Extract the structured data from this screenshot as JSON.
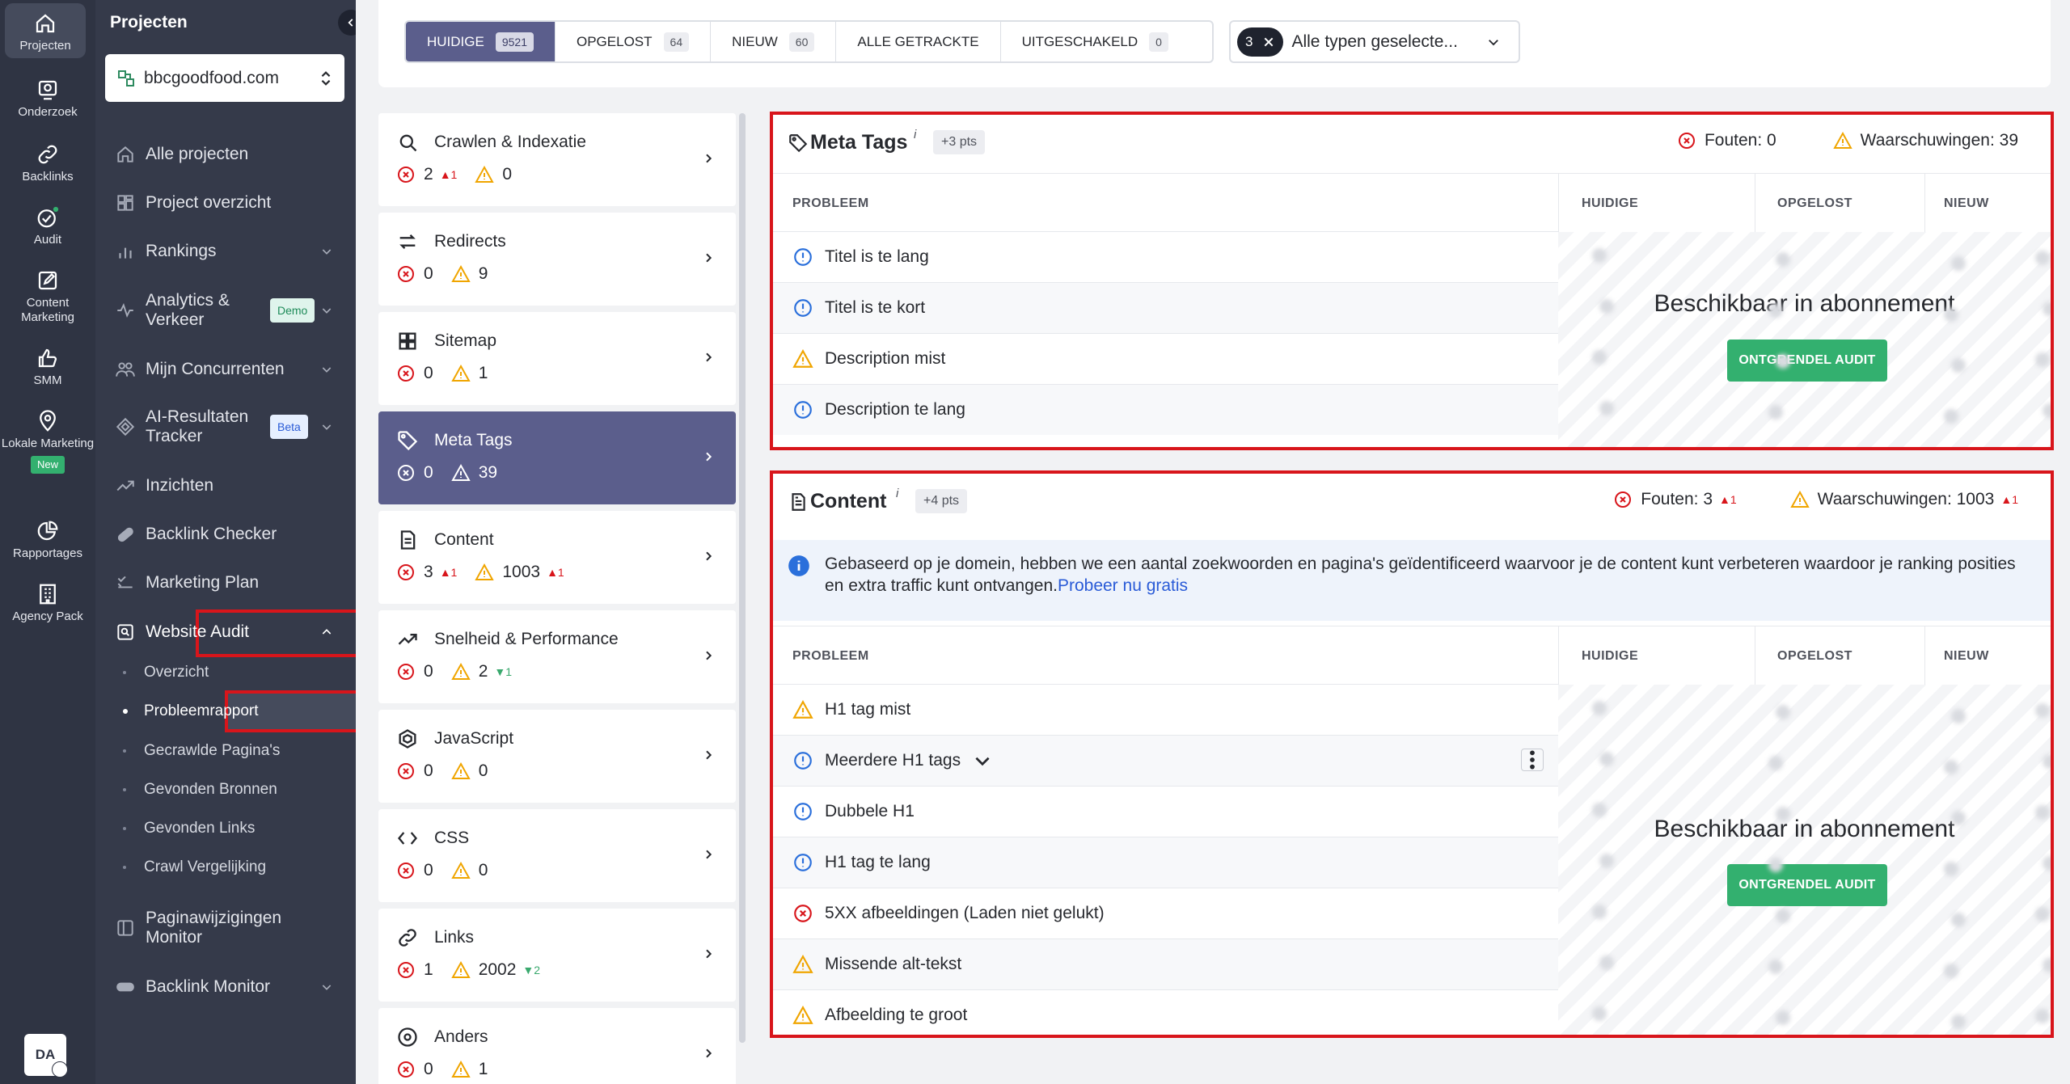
{
  "rail": {
    "items": [
      {
        "label": "Projecten",
        "icon": "home-icon"
      },
      {
        "label": "Onderzoek",
        "icon": "research-icon"
      },
      {
        "label": "Backlinks",
        "icon": "link-icon"
      },
      {
        "label": "Audit",
        "icon": "check-circle-icon"
      },
      {
        "label": "Content Marketing",
        "icon": "edit-icon"
      },
      {
        "label": "SMM",
        "icon": "thumbs-up-icon"
      },
      {
        "label": "Lokale Marketing",
        "icon": "map-pin-icon",
        "badge": "New"
      },
      {
        "label": "Rapportages",
        "icon": "pie-chart-icon"
      },
      {
        "label": "Agency Pack",
        "icon": "building-icon"
      }
    ],
    "avatar": "DA"
  },
  "sidebar": {
    "title": "Projecten",
    "project": "bbcgoodfood.com",
    "nav": [
      {
        "label": "Alle projecten"
      },
      {
        "label": "Project overzicht"
      },
      {
        "label": "Rankings"
      },
      {
        "label": "Analytics & Verkeer",
        "badge": "Demo"
      },
      {
        "label": "Mijn Concurrenten"
      },
      {
        "label": "AI-Resultaten Tracker",
        "badge": "Beta"
      },
      {
        "label": "Inzichten"
      },
      {
        "label": "Backlink Checker"
      },
      {
        "label": "Marketing Plan"
      },
      {
        "label": "Website Audit"
      },
      {
        "label": "Paginawijzigingen Monitor"
      },
      {
        "label": "Backlink Monitor"
      }
    ],
    "audit_sub": [
      "Overzicht",
      "Probleemrapport",
      "Gecrawlde Pagina's",
      "Gevonden Bronnen",
      "Gevonden Links",
      "Crawl Vergelijking"
    ]
  },
  "tabs": [
    {
      "label": "HUIDIGE",
      "count": "9521"
    },
    {
      "label": "OPGELOST",
      "count": "64"
    },
    {
      "label": "NIEUW",
      "count": "60"
    },
    {
      "label": "ALLE GETRACKTE",
      "count": ""
    },
    {
      "label": "UITGESCHAKELD",
      "count": "0"
    }
  ],
  "type_filter": {
    "count": "3",
    "label": "Alle typen geselecte..."
  },
  "categories": [
    {
      "name": "Crawlen & Indexatie",
      "errors": "2",
      "errors_delta": "1",
      "warnings": "0"
    },
    {
      "name": "Redirects",
      "errors": "0",
      "warnings": "9"
    },
    {
      "name": "Sitemap",
      "errors": "0",
      "warnings": "1"
    },
    {
      "name": "Meta Tags",
      "errors": "0",
      "warnings": "39"
    },
    {
      "name": "Content",
      "errors": "3",
      "errors_delta": "1",
      "warnings": "1003",
      "warnings_delta": "1"
    },
    {
      "name": "Snelheid & Performance",
      "errors": "0",
      "warnings": "2",
      "warnings_delta": "1"
    },
    {
      "name": "JavaScript",
      "errors": "0",
      "warnings": "0"
    },
    {
      "name": "CSS",
      "errors": "0",
      "warnings": "0"
    },
    {
      "name": "Links",
      "errors": "1",
      "warnings": "2002",
      "warnings_delta": "2"
    },
    {
      "name": "Anders",
      "errors": "0",
      "warnings": "1"
    }
  ],
  "columns": {
    "problem": "PROBLEEM",
    "current": "HUIDIGE",
    "fixed": "OPGELOST",
    "new": "NIEUW"
  },
  "locked": {
    "text": "Beschikbaar in abonnement",
    "button": "ONTGRENDEL AUDIT"
  },
  "meta_panel": {
    "title": "Meta Tags",
    "info": "i",
    "pts": "+3 pts",
    "errors_label": "Fouten: 0",
    "warnings_label": "Waarschuwingen: 39",
    "rows": [
      {
        "label": "Titel is te lang",
        "type": "info"
      },
      {
        "label": "Titel is te kort",
        "type": "info"
      },
      {
        "label": "Description mist",
        "type": "warning"
      },
      {
        "label": "Description te lang",
        "type": "info"
      }
    ]
  },
  "content_panel": {
    "title": "Content",
    "info": "i",
    "pts": "+4 pts",
    "errors_label": "Fouten: 3",
    "errors_delta": "1",
    "warnings_label": "Waarschuwingen: 1003",
    "warnings_delta": "1",
    "banner": "Gebaseerd op je domein, hebben we een aantal zoekwoorden en pagina's geïdentificeerd waarvoor je de content kunt verbeteren waardoor je ranking posities en extra traffic kunt ontvangen.",
    "banner_link": "Probeer nu gratis",
    "rows": [
      {
        "label": "H1 tag mist",
        "type": "warning"
      },
      {
        "label": "Meerdere H1 tags",
        "type": "info"
      },
      {
        "label": "Dubbele H1",
        "type": "info"
      },
      {
        "label": "H1 tag te lang",
        "type": "info"
      },
      {
        "label": "5XX afbeeldingen (Laden niet gelukt)",
        "type": "error"
      },
      {
        "label": "Missende alt-tekst",
        "type": "warning"
      },
      {
        "label": "Afbeelding te groot",
        "type": "warning"
      }
    ]
  },
  "colors": {
    "accent": "#5b5e8c",
    "error": "#d8151b",
    "warning": "#f0a500",
    "info": "#2a6fdb",
    "success": "#33b06f"
  }
}
